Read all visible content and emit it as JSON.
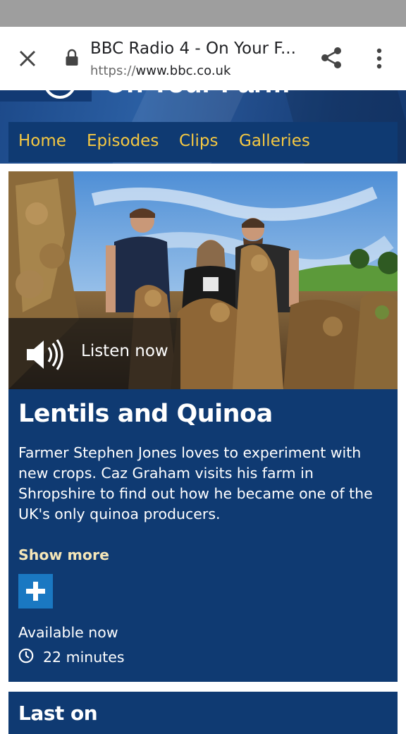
{
  "browser": {
    "page_title": "BBC Radio 4 - On Your F...",
    "url_scheme": "https://",
    "url_host": "www.bbc.co.uk",
    "icons": [
      "close-icon",
      "lock-icon",
      "share-icon",
      "more-vert-icon"
    ]
  },
  "header": {
    "brand": "On Your Farm"
  },
  "nav": {
    "items": [
      {
        "label": "Home"
      },
      {
        "label": "Episodes"
      },
      {
        "label": "Clips"
      },
      {
        "label": "Galleries"
      }
    ]
  },
  "episode": {
    "listen_label": "Listen now",
    "title": "Lentils and Quinoa",
    "description": "Farmer Stephen Jones loves to experiment with new crops. Caz Graham visits his farm in Shropshire to find out how he became one of the UK's only quinoa producers.",
    "show_more_label": "Show more",
    "availability": "Available now",
    "duration": "22 minutes"
  },
  "last_on": {
    "title": "Last on"
  },
  "colors": {
    "nav_text": "#f5c842",
    "card_bg": "#0f3a72",
    "plus_button": "#1a78c2",
    "show_more": "#f5e6b8"
  }
}
